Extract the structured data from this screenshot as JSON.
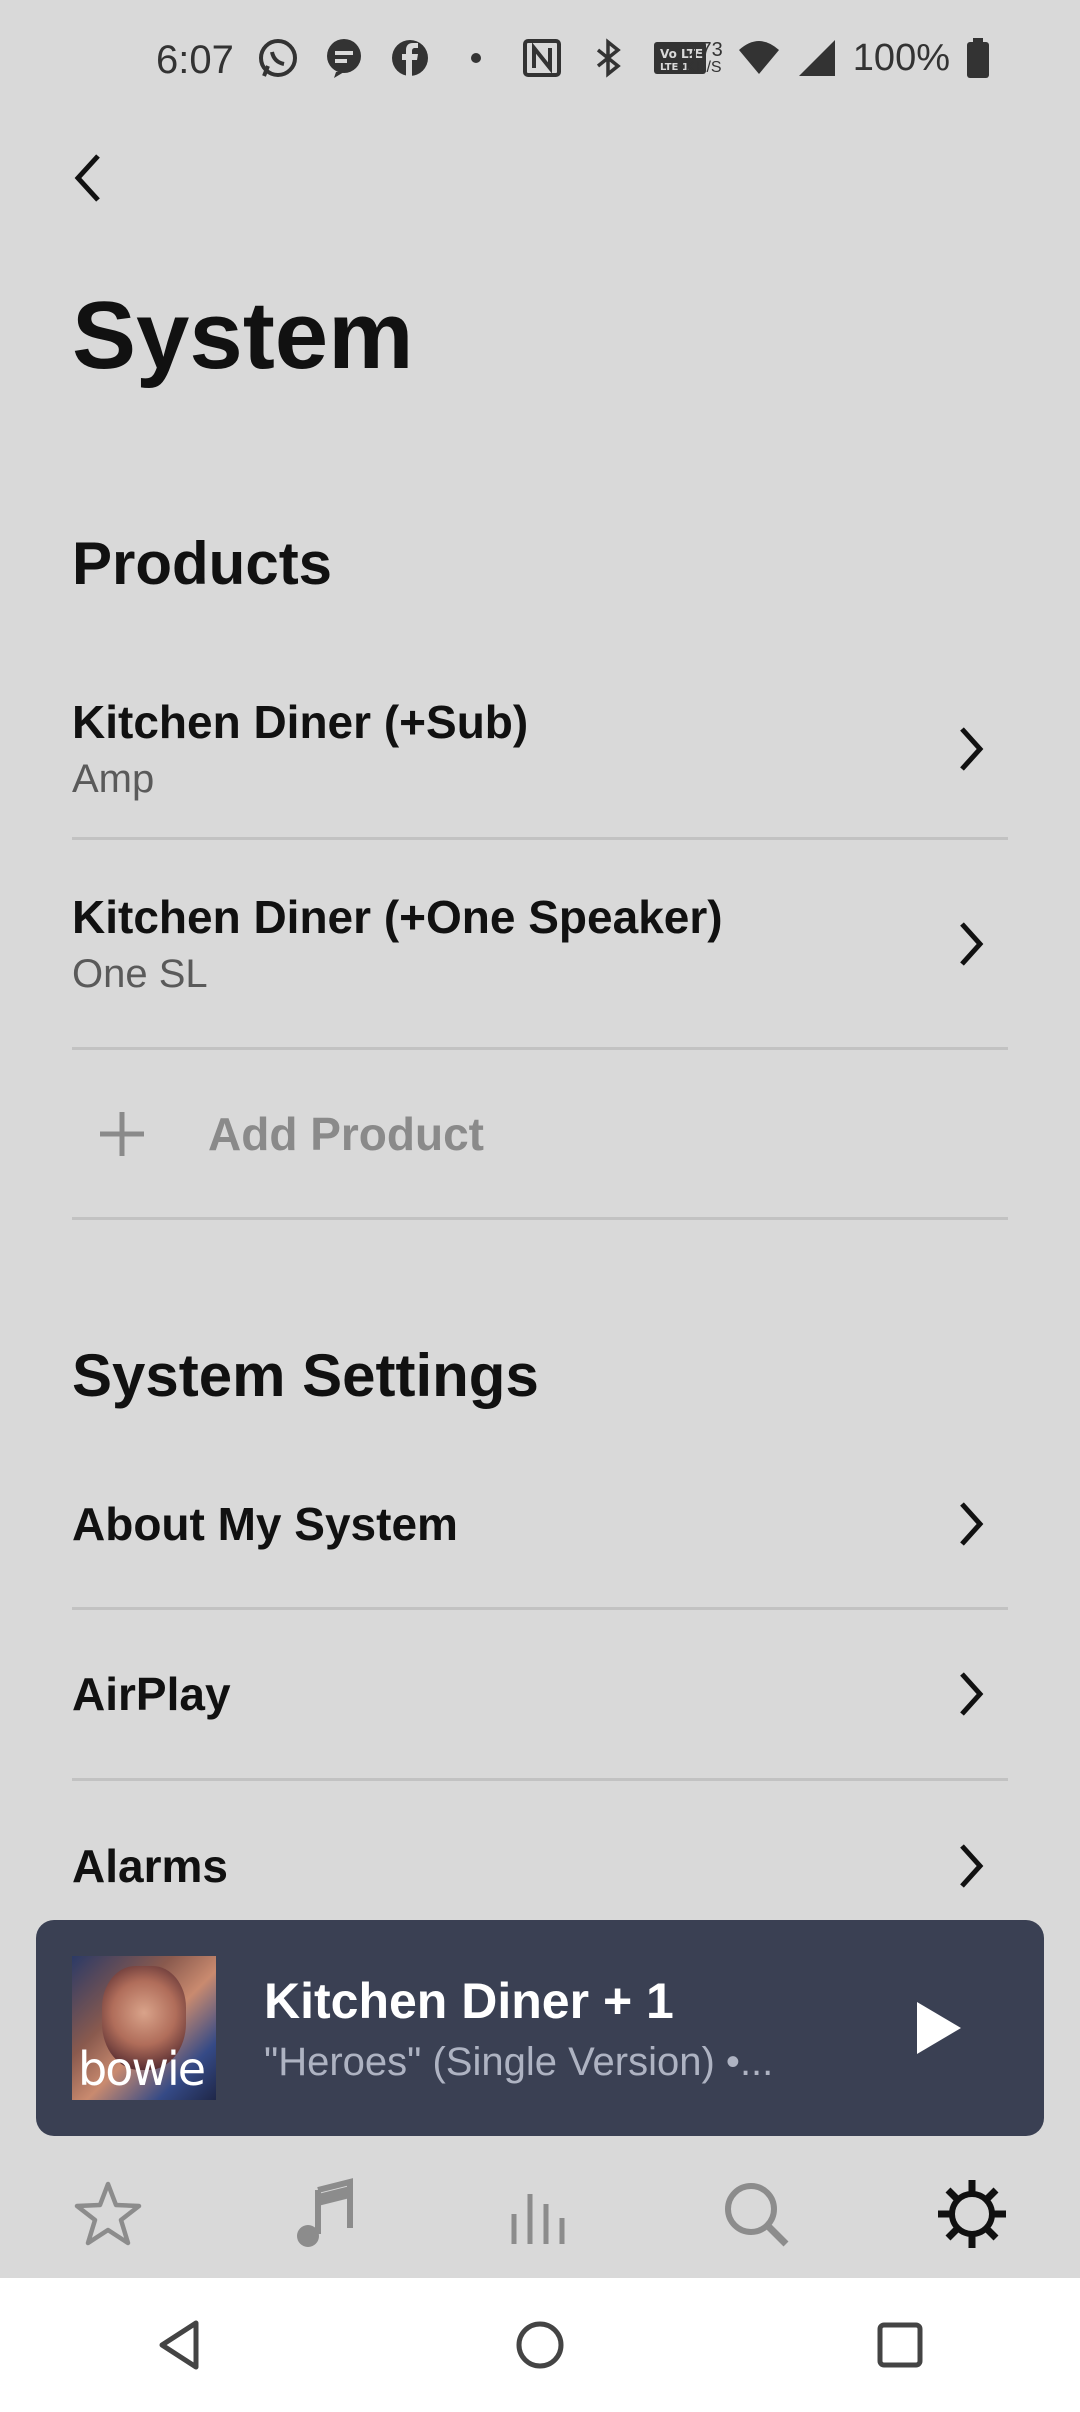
{
  "status_bar": {
    "time": "6:07",
    "net_speed_value": "0.73",
    "net_speed_unit": "KB/S",
    "battery": "100%",
    "icons": [
      "whatsapp-icon",
      "message-icon",
      "facebook-icon",
      "dot-icon",
      "nfc-icon",
      "bluetooth-icon",
      "volte-icon",
      "wifi-icon",
      "signal-icon",
      "battery-icon"
    ]
  },
  "header": {
    "title": "System"
  },
  "products": {
    "heading": "Products",
    "items": [
      {
        "title": "Kitchen Diner (+Sub)",
        "subtitle": "Amp"
      },
      {
        "title": "Kitchen Diner (+One Speaker)",
        "subtitle": "One SL"
      }
    ],
    "add_label": "Add Product"
  },
  "system_settings": {
    "heading": "System Settings",
    "items": [
      {
        "title": "About My System"
      },
      {
        "title": "AirPlay"
      },
      {
        "title": "Alarms"
      }
    ]
  },
  "now_playing": {
    "room": "Kitchen Diner + 1",
    "track": "\"Heroes\" (Single Version) •...",
    "album_art_text": "bowie"
  },
  "tabs": [
    "favorites-star-icon",
    "music-note-icon",
    "rooms-bars-icon",
    "search-icon",
    "settings-gear-icon"
  ],
  "colors": {
    "background": "#d9d9d9",
    "now_playing_bg": "#3a4053",
    "divider": "#c2c2c2"
  }
}
